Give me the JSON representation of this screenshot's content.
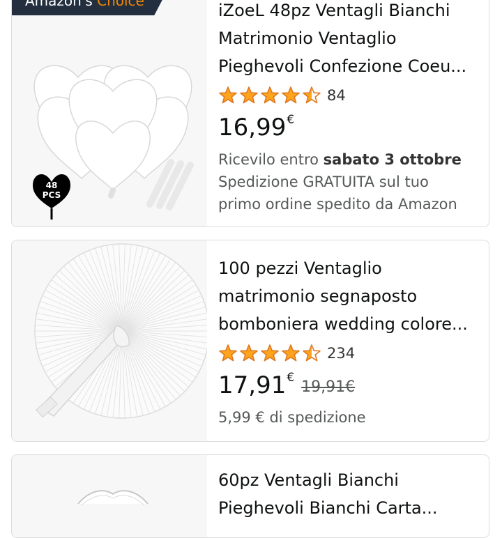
{
  "products": [
    {
      "badge_prefix": "Amazon's",
      "badge_highlight": "Choice",
      "title_lines": [
        "iZoeL 48pz Ventagli Bianchi",
        "Matrimonio Ventaglio",
        "Pieghevoli Confezione Coeu..."
      ],
      "rating": 4.5,
      "rating_count": "84",
      "price": "16,99",
      "currency": "€",
      "delivery_prefix": "Ricevilo entro ",
      "delivery_date": "sabato 3 ottobre",
      "shipping_lines": [
        "Spedizione GRATUITA sul tuo",
        "primo ordine spedito da Amazon"
      ],
      "image_tag_lines": [
        "48",
        "PCS"
      ]
    },
    {
      "title_lines": [
        "100 pezzi Ventaglio",
        "matrimonio segnaposto",
        "bomboniera wedding colore..."
      ],
      "rating": 4.5,
      "rating_count": "234",
      "price": "17,91",
      "currency": "€",
      "old_price": "19,91€",
      "shipping": "5,99 € di spedizione"
    },
    {
      "title_lines": [
        "60pz Ventagli Bianchi",
        "Pieghevoli Bianchi Carta..."
      ]
    }
  ],
  "colors": {
    "star": "#ffa41c",
    "badge_bg": "#232f3e",
    "badge_accent": "#f08804"
  }
}
